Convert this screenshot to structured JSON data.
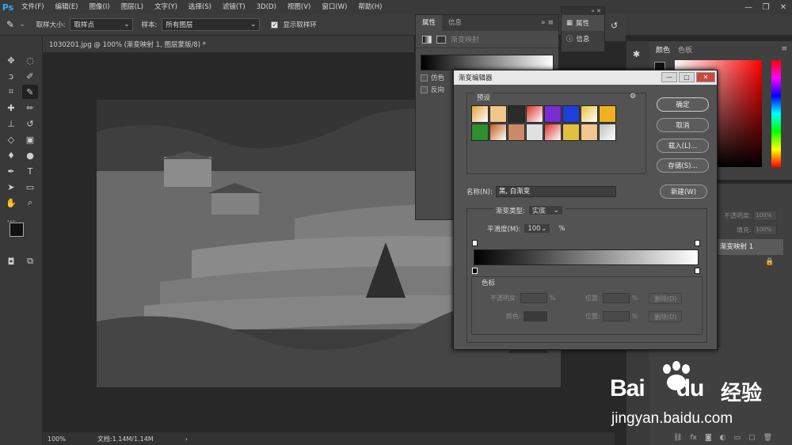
{
  "app": {
    "logo": "Ps"
  },
  "menubar": {
    "items": [
      "文件(F)",
      "编辑(E)",
      "图像(I)",
      "图层(L)",
      "文字(Y)",
      "选择(S)",
      "滤镜(T)",
      "3D(D)",
      "视图(V)",
      "窗口(W)",
      "帮助(H)"
    ]
  },
  "window_controls": {
    "minimize": "—",
    "restore": "❐",
    "close": "✕"
  },
  "options": {
    "sample_size_label": "取样大小:",
    "sample_size_value": "取样点",
    "sample_label": "样本:",
    "sample_value": "所有图层",
    "show_ring_label": "显示取样环",
    "show_ring_checked": true
  },
  "document": {
    "tab_title": "1030201.jpg @ 100% (渐变映射 1, 图层蒙版/8) *",
    "zoom": "100%",
    "doc_info": "文档:1.14M/1.14M"
  },
  "properties_panel": {
    "tabs": [
      "属性",
      "信息"
    ],
    "header_label": "渐变映射",
    "dither_label": "仿色",
    "reverse_label": "反向"
  },
  "mid_panel": {
    "items": [
      "属性",
      "信息"
    ]
  },
  "color_panel": {
    "tabs": [
      "颜色",
      "色板"
    ]
  },
  "layers_panel": {
    "opacity_label": "不透明度:",
    "opacity_value": "100%",
    "fill_label": "填充:",
    "fill_value": "100%",
    "layer_name": "渐变映射 1"
  },
  "gradient_editor": {
    "title": "渐变编辑器",
    "presets_label": "预设",
    "buttons": {
      "ok": "确定",
      "cancel": "取消",
      "load": "载入(L)...",
      "save": "存储(S)...",
      "new": "新建(W)"
    },
    "name_label": "名称(N):",
    "name_value": "黑, 白渐变",
    "gradient_type_label": "渐变类型:",
    "gradient_type_value": "实底",
    "smoothness_label": "平滑度(M):",
    "smoothness_value": "100",
    "smoothness_unit": "%",
    "stops_label": "色标",
    "opacity_label": "不透明度:",
    "location_label": "位置:",
    "color_label": "颜色:",
    "percent": "%",
    "delete_label": "删除(D)",
    "swatch_colors": [
      "#e8a33a",
      "#f3c68a",
      "#2b2b2b",
      "#d9342b",
      "#7a2dd1",
      "#1f3fd9",
      "#e6c23a",
      "#f0b020",
      "#2f8f2f",
      "#c25a1e",
      "#c98a6a",
      "#e0e0e0",
      "#d9342b",
      "#e0c040",
      "#f0c890",
      "#bfbfbf"
    ]
  },
  "watermark": {
    "brand": "Bai",
    "brand2": "du",
    "cn": "经验",
    "url": "jingyan.baidu.com"
  }
}
